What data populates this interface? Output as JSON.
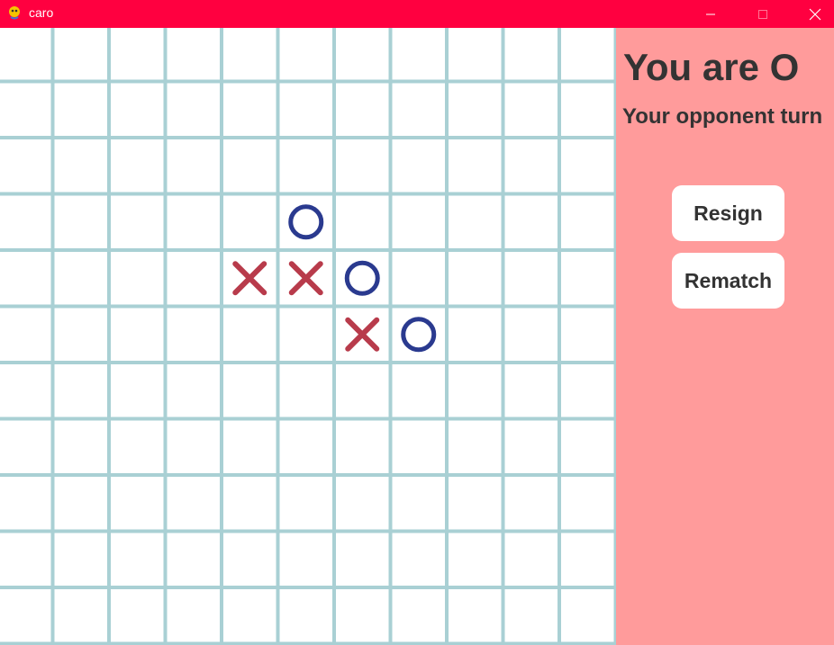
{
  "window": {
    "title": "caro",
    "app_icon": "pygame-snake-icon",
    "controls": [
      "minimize-icon",
      "maximize-icon",
      "close-icon"
    ],
    "titlebar_color": "#ff0040"
  },
  "board": {
    "rows": 11,
    "cols": 11,
    "grid_color": "#a9d0d4",
    "x_color": "#b83b4b",
    "o_color": "#2a3a8f",
    "pieces": [
      {
        "row": 3,
        "col": 5,
        "mark": "O"
      },
      {
        "row": 4,
        "col": 4,
        "mark": "X"
      },
      {
        "row": 4,
        "col": 5,
        "mark": "X"
      },
      {
        "row": 4,
        "col": 6,
        "mark": "O"
      },
      {
        "row": 5,
        "col": 6,
        "mark": "X"
      },
      {
        "row": 5,
        "col": 7,
        "mark": "O"
      }
    ]
  },
  "panel": {
    "background": "#ff9b9b",
    "player_text": "You are O",
    "turn_text": "Your opponent turn",
    "resign_label": "Resign",
    "rematch_label": "Rematch"
  }
}
